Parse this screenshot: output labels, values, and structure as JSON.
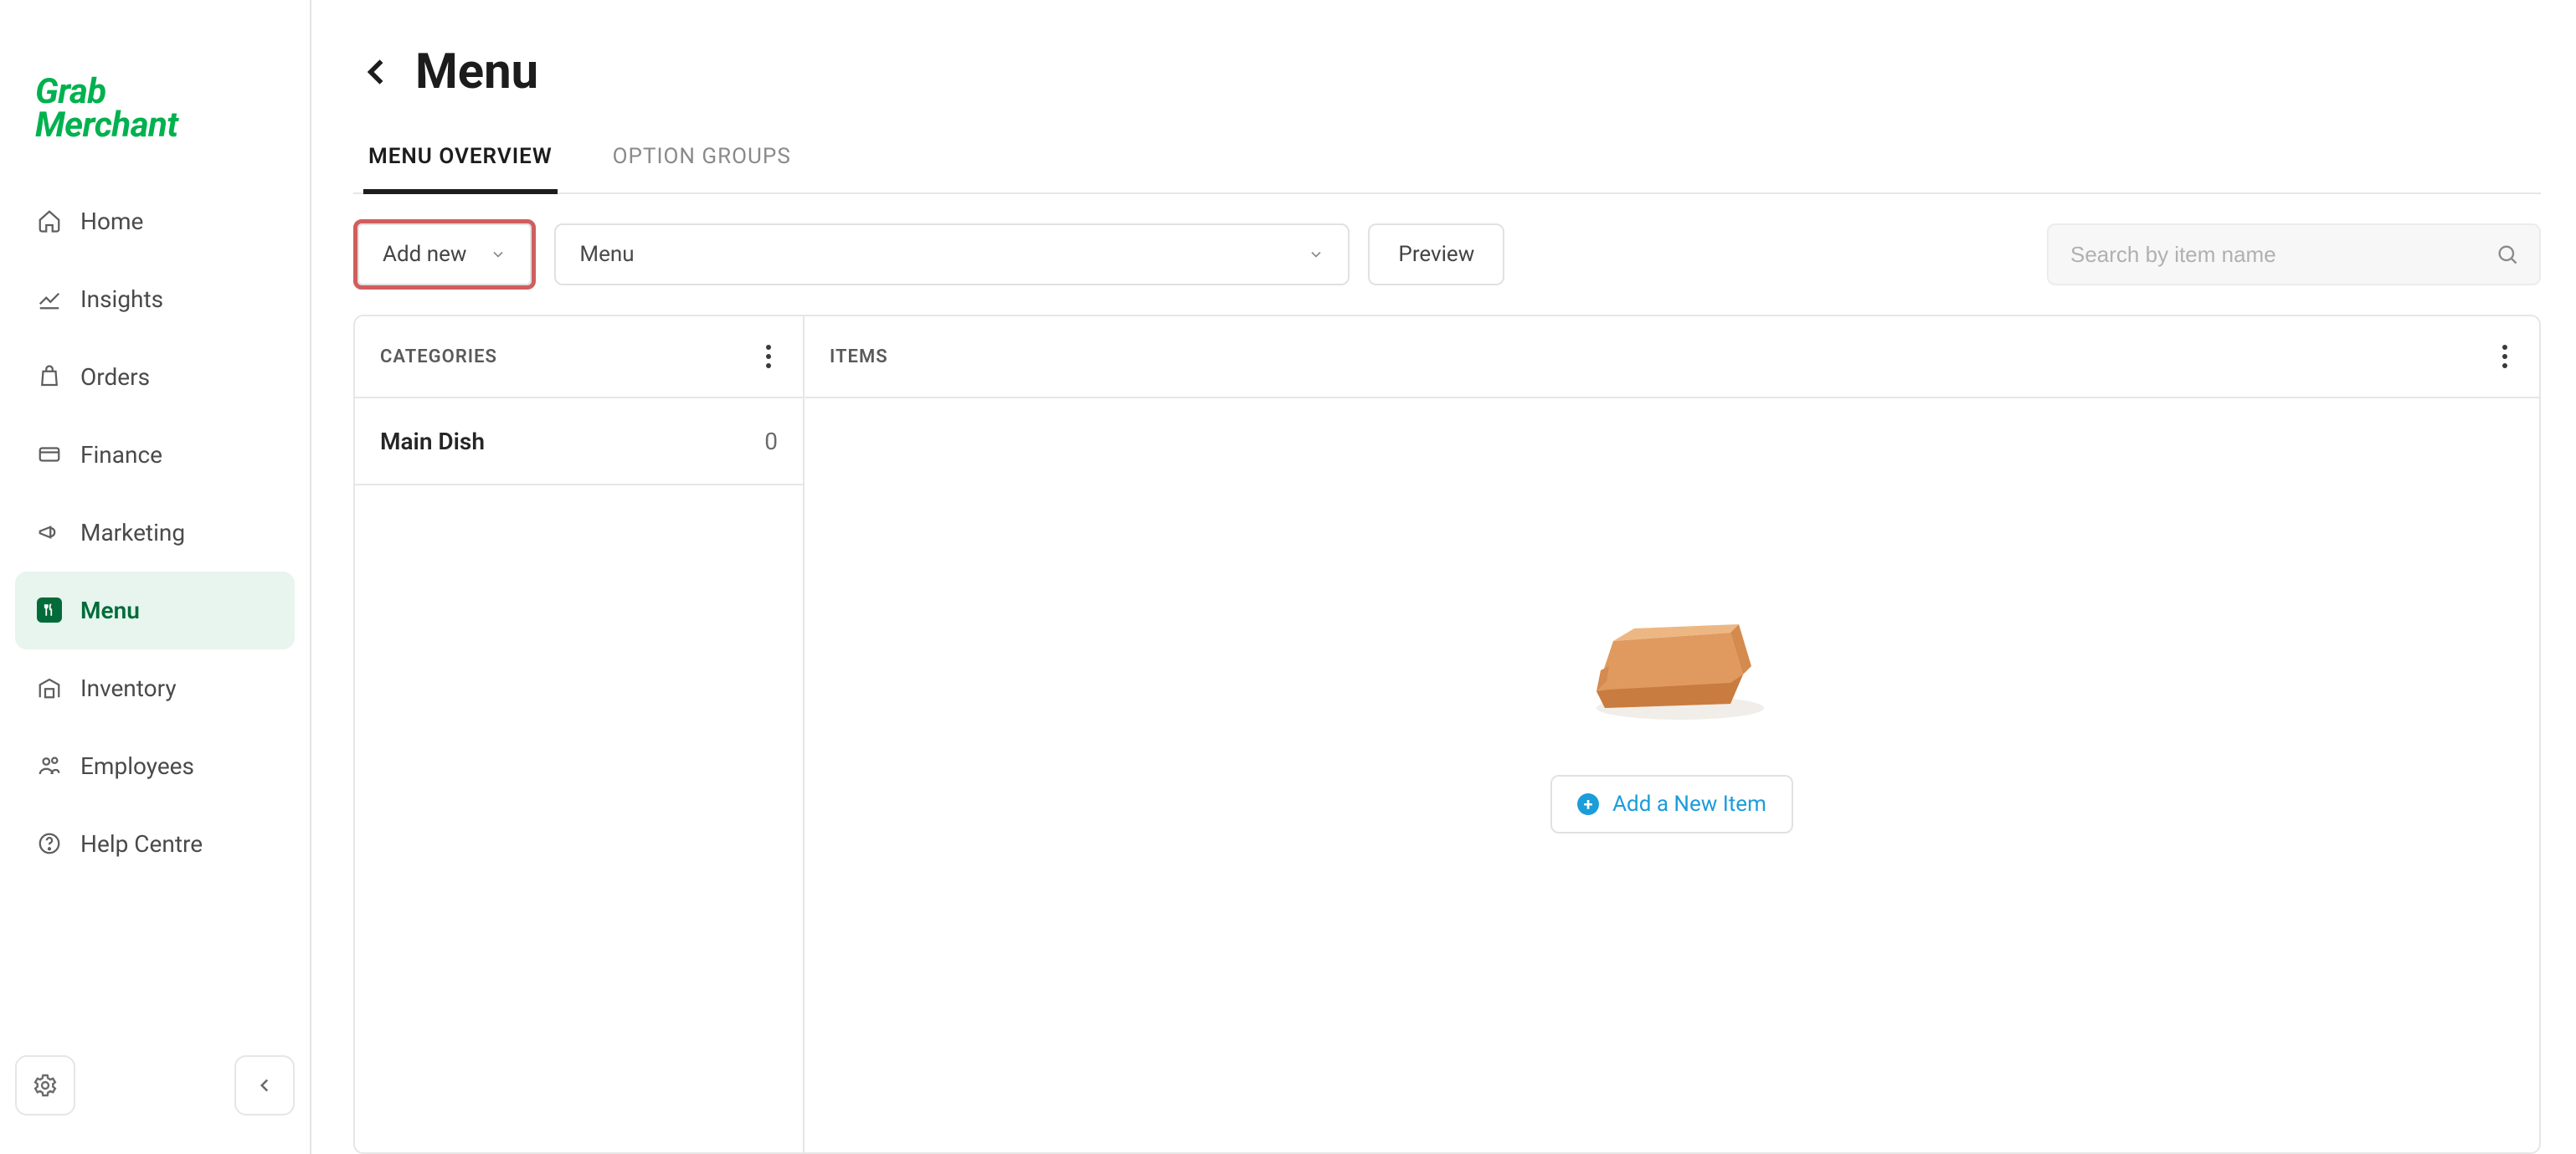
{
  "brand": {
    "line1": "Grab",
    "line2": "Merchant"
  },
  "sidebar": {
    "items": [
      {
        "label": "Home",
        "icon": "home-icon"
      },
      {
        "label": "Insights",
        "icon": "chart-icon"
      },
      {
        "label": "Orders",
        "icon": "bag-icon"
      },
      {
        "label": "Finance",
        "icon": "card-icon"
      },
      {
        "label": "Marketing",
        "icon": "megaphone-icon"
      },
      {
        "label": "Menu",
        "icon": "menu-icon"
      },
      {
        "label": "Inventory",
        "icon": "warehouse-icon"
      },
      {
        "label": "Employees",
        "icon": "people-icon"
      },
      {
        "label": "Help Centre",
        "icon": "help-icon"
      }
    ],
    "active_index": 5
  },
  "page": {
    "title": "Menu"
  },
  "tabs": {
    "items": [
      "MENU OVERVIEW",
      "OPTION GROUPS"
    ],
    "active_index": 0
  },
  "toolbar": {
    "add_new_label": "Add new",
    "menu_select_value": "Menu",
    "preview_label": "Preview",
    "search_placeholder": "Search by item name"
  },
  "panels": {
    "categories_header": "CATEGORIES",
    "items_header": "ITEMS",
    "categories": [
      {
        "name": "Main Dish",
        "count": "0"
      }
    ],
    "add_item_label": "Add a New Item"
  },
  "annotation": {
    "highlight_add_new": true
  }
}
